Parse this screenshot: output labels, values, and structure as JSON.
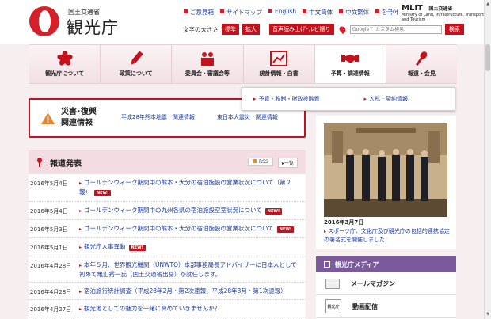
{
  "header": {
    "logo_sub": "国土交通省",
    "logo_main": "観光庁",
    "top_links": [
      "ご意見箱",
      "サイトマップ",
      "English",
      "中文简体",
      "中文繁体",
      "한국어"
    ],
    "mlit_logo": "MLIT",
    "mlit_name": "国土交通省",
    "mlit_english": "Ministry of Land, Infrastructure, Transport and Tourism",
    "text_size_label": "文字の大きさ",
    "text_size_buttons": [
      "標準",
      "拡大"
    ],
    "speech_button": "音声読み上げ･ルビ振り",
    "search_placeholder": "Google™ カスタム検索",
    "search_button": "検索"
  },
  "nav": [
    {
      "label": "観光庁について",
      "icon": "sakura-icon"
    },
    {
      "label": "政策について",
      "icon": "pencil-icon"
    },
    {
      "label": "委員会・審議会等",
      "icon": "people-icon"
    },
    {
      "label": "統計情報・白書",
      "icon": "chart-icon"
    },
    {
      "label": "予算・調達情報",
      "icon": "handshake-icon"
    },
    {
      "label": "報道・会見",
      "icon": "microphone-icon"
    }
  ],
  "dropdown": [
    "予算・税制・財政投融資",
    "入札・契約情報"
  ],
  "disaster": {
    "title": "災害･復興\n関連情報",
    "links": [
      "平成28年熊本地震　関連情報",
      "東日本大震災　関連情報"
    ]
  },
  "press": {
    "title": "報道発表",
    "rss": "RSS",
    "list_button": "一覧",
    "new_label": "NEW!",
    "items": [
      {
        "date": "2016年5月4日",
        "text": "ゴールデンウィーク期間中の熊本・大分の宿泊施設の営業状況について（第２報）",
        "new": true
      },
      {
        "date": "2016年5月4日",
        "text": "ゴールデンウィーク期間中の九州各県の宿泊施設空室状況について",
        "new": true
      },
      {
        "date": "2016年5月3日",
        "text": "ゴールデンウィーク期間中の熊本・大分の宿泊施設の営業状況について",
        "new": true
      },
      {
        "date": "2016年5月1日",
        "text": "観光庁人事異動",
        "new": true
      },
      {
        "date": "2016年4月28日",
        "text": "本年５月、世界観光機関（UNWTO）本部事務局長アドバイザーに日本人として初めて亀山秀一氏（国土交通省出身）が就任します。",
        "new": false
      },
      {
        "date": "2016年4月28日",
        "text": "宿泊旅行統計調査（平成28年2月・第2次速報、平成28年3月・第1次速報）",
        "new": false
      },
      {
        "date": "2016年4月27日",
        "text": "観光地としての魅力を一緒に高めていきませんか？",
        "new": false
      }
    ]
  },
  "photo": {
    "date": "2016年3月7日",
    "caption": "スポーツ庁、文化庁及び観光庁の包括的連携協定の署名式を開催しました！"
  },
  "media": {
    "title": "観光庁メディア",
    "items": [
      "メールマガジン",
      "動画配信"
    ],
    "video_tag": "観光庁"
  },
  "colors": {
    "accent": "#c4121d",
    "nav_bg": "#f4dde2",
    "media": "#7a5a9a"
  }
}
